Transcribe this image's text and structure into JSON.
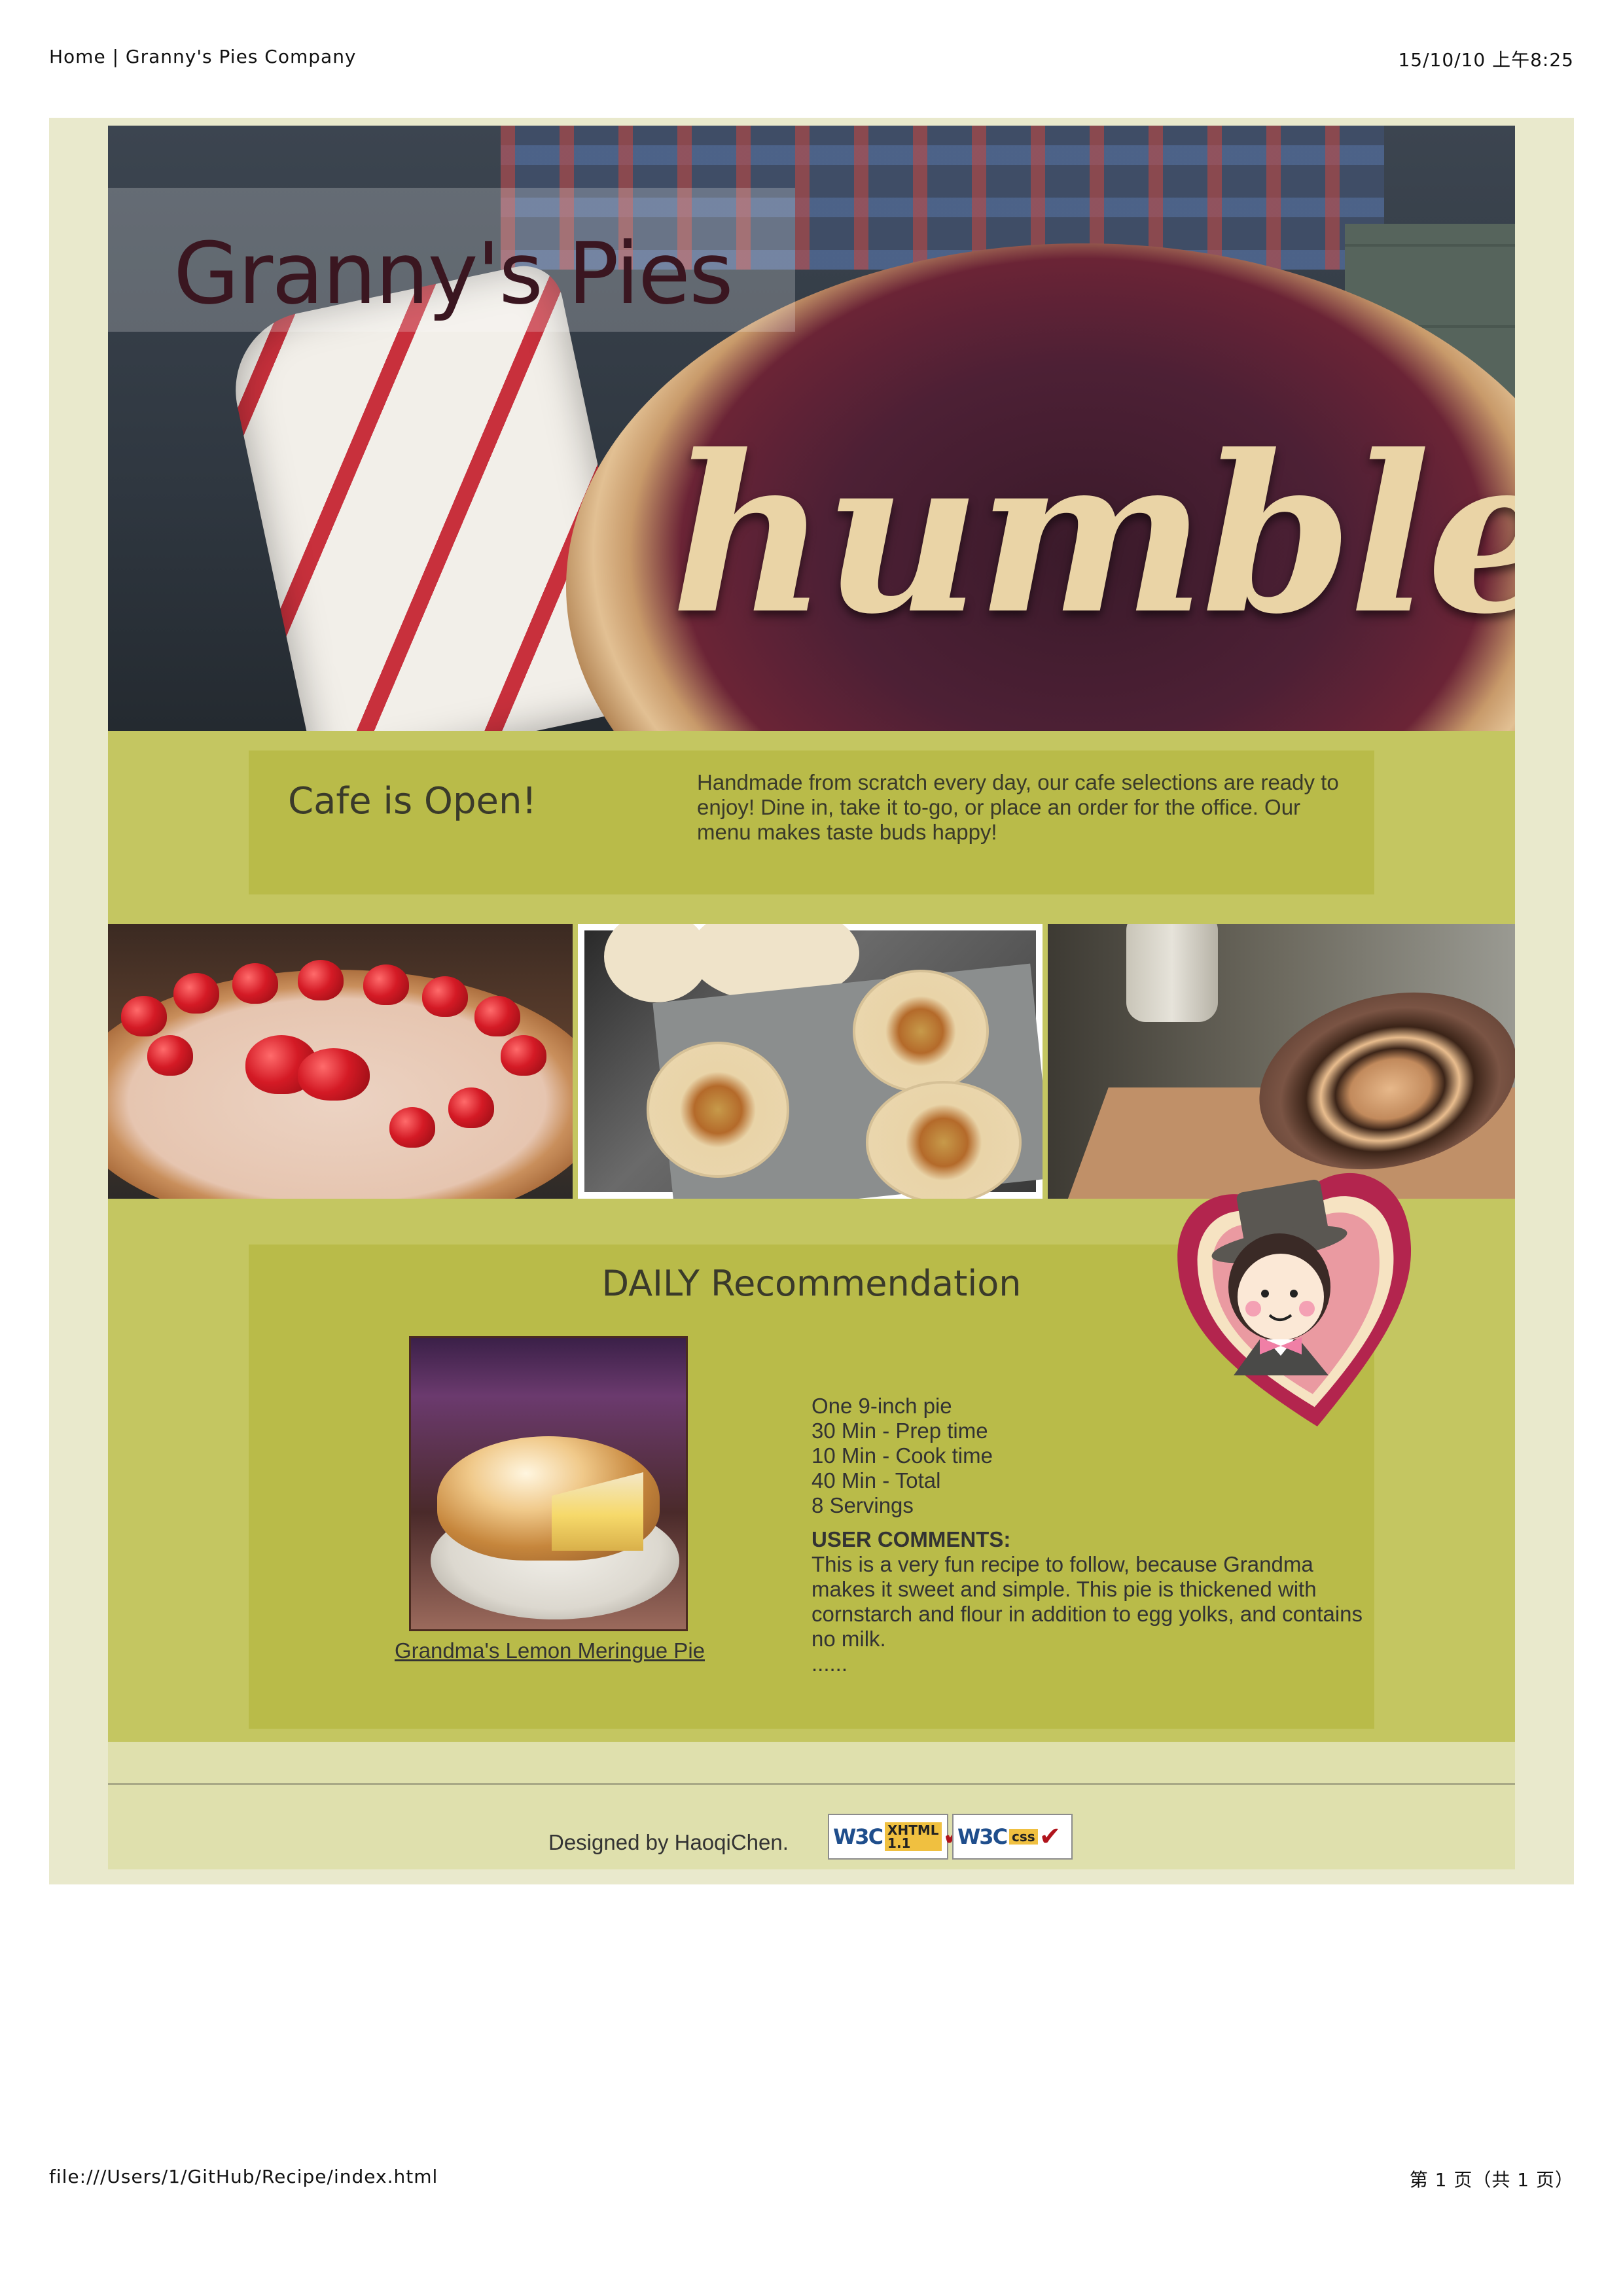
{
  "print_header": {
    "title": "Home | Granny's Pies Company",
    "datetime": "15/10/10 上午8:25"
  },
  "print_footer": {
    "url": "file:///Users/1/GitHub/Recipe/index.html",
    "page": "第 1 页（共 1 页）"
  },
  "hero": {
    "site_title": "Granny's Pies",
    "pie_word": "humble"
  },
  "cafe": {
    "title": "Cafe is Open!",
    "text": "Handmade from scratch every day, our cafe selections are ready to enjoy! Dine in, take it to-go, or place an order for the office. Our menu makes taste buds happy!"
  },
  "recommendation": {
    "title": "DAILY Recommendation",
    "recipe_link": "Grandma's Lemon Meringue Pie",
    "details": [
      "One 9-inch pie",
      "30 Min - Prep time",
      "10 Min - Cook time",
      "40 Min - Total",
      "8 Servings"
    ],
    "comments_heading": "USER COMMENTS:",
    "comments_text": "This is a very fun recipe to follow, because Grandma makes it sweet and simple. This pie is thickened with cornstarch and flour in addition to egg yolks, and contains no milk.",
    "comments_more": "......"
  },
  "footer": {
    "designed_by": "Designed by HaoqiChen.",
    "badges": [
      {
        "logo": "W3C",
        "label": "XHTML 1.1"
      },
      {
        "logo": "W3C",
        "label": "css"
      }
    ]
  },
  "colors": {
    "page_bg": "#c4c661",
    "box_bg": "#b9bb49",
    "outer_bg": "#e9e9cc",
    "title": "#3a1620"
  }
}
